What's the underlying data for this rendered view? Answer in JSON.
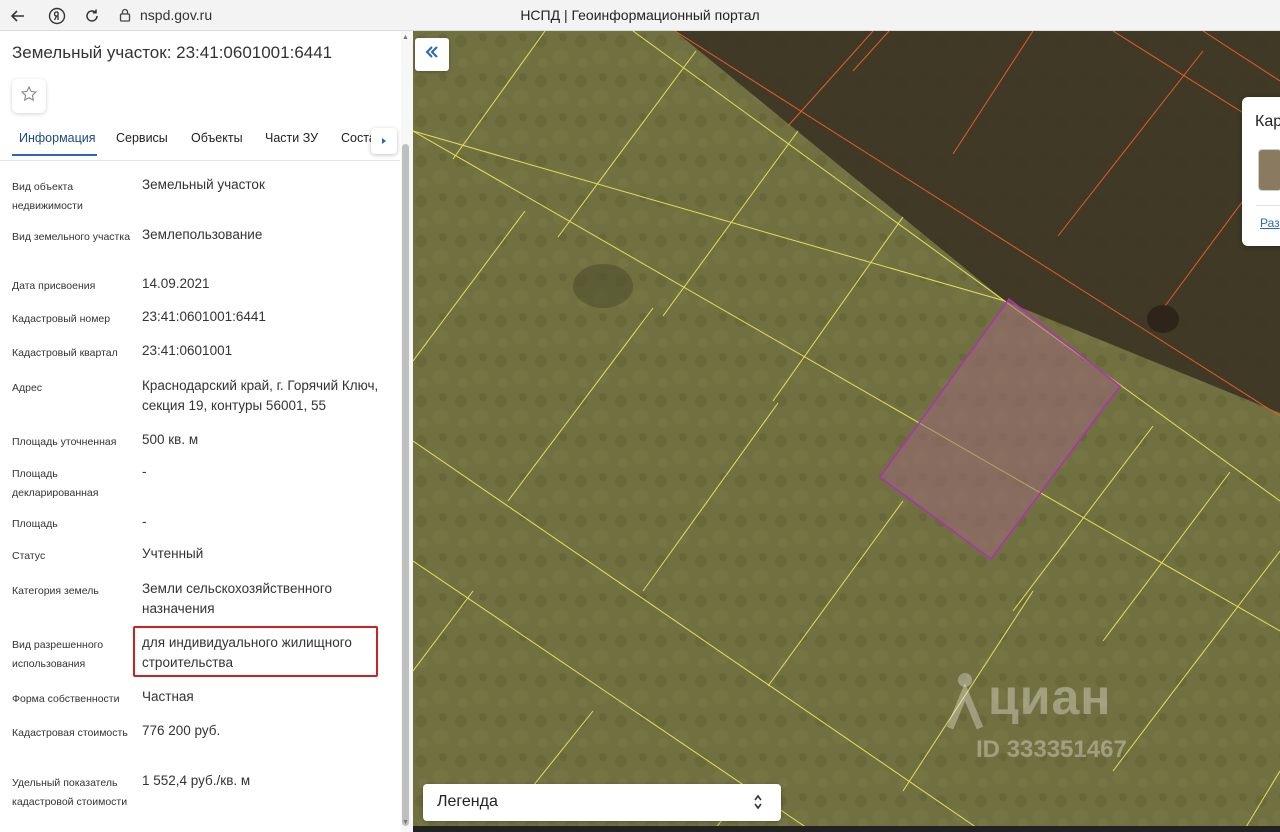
{
  "browser": {
    "url": "nspd.gov.ru",
    "tab_title": "НСПД | Геоинформационный портал",
    "icons": [
      "back-arrow-icon",
      "yandex-icon",
      "reload-icon",
      "lock-icon"
    ]
  },
  "panel": {
    "title": "Земельный участок: 23:41:0601001:6441",
    "tabs": [
      "Информация",
      "Сервисы",
      "Объекты",
      "Части ЗУ",
      "Соста"
    ],
    "active_tab": "Информация",
    "rows": [
      {
        "label": "Вид объекта недвижимости",
        "value": "Земельный участок"
      },
      {
        "label": "Вид земельного участка",
        "value": "Землепользование"
      },
      {
        "label": "Дата присвоения",
        "value": "14.09.2021"
      },
      {
        "label": "Кадастровый номер",
        "value": "23:41:0601001:6441"
      },
      {
        "label": "Кадастровый квартал",
        "value": "23:41:0601001"
      },
      {
        "label": "Адрес",
        "value": "Краснодарский край, г. Горячий Ключ, секция 19, контуры 56001, 55"
      },
      {
        "label": "Площадь уточненная",
        "value": "500 кв. м"
      },
      {
        "label": "Площадь декларированная",
        "value": "-"
      },
      {
        "label": "Площадь",
        "value": "-"
      },
      {
        "label": "Статус",
        "value": "Учтенный"
      },
      {
        "label": "Категория земель",
        "value": "Земли сельскохозяйственного назначения"
      },
      {
        "label": "Вид разрешенного использования",
        "value": "для индивидуального жилищного строительства"
      },
      {
        "label": "Форма собственности",
        "value": "Частная"
      },
      {
        "label": "Кадастровая стоимость",
        "value": "776 200 руб."
      },
      {
        "label": "Удельный показатель кадастровой стоимости",
        "value": "1 552,4 руб./кв. м"
      }
    ],
    "highlight_color": "#d0201f"
  },
  "map": {
    "legend_label": "Легенда",
    "card_title": "Кар",
    "card_link": "Раз",
    "watermark_text": "циан",
    "watermark_id": "ID 333351467",
    "colors": {
      "parcel_lines": "#e6e05a",
      "boundary_lines": "#e85a2a",
      "selected_parcel_stroke": "#b02fb8",
      "selected_parcel_fill": "#9a6a78",
      "accent": "#2b65b5"
    }
  }
}
